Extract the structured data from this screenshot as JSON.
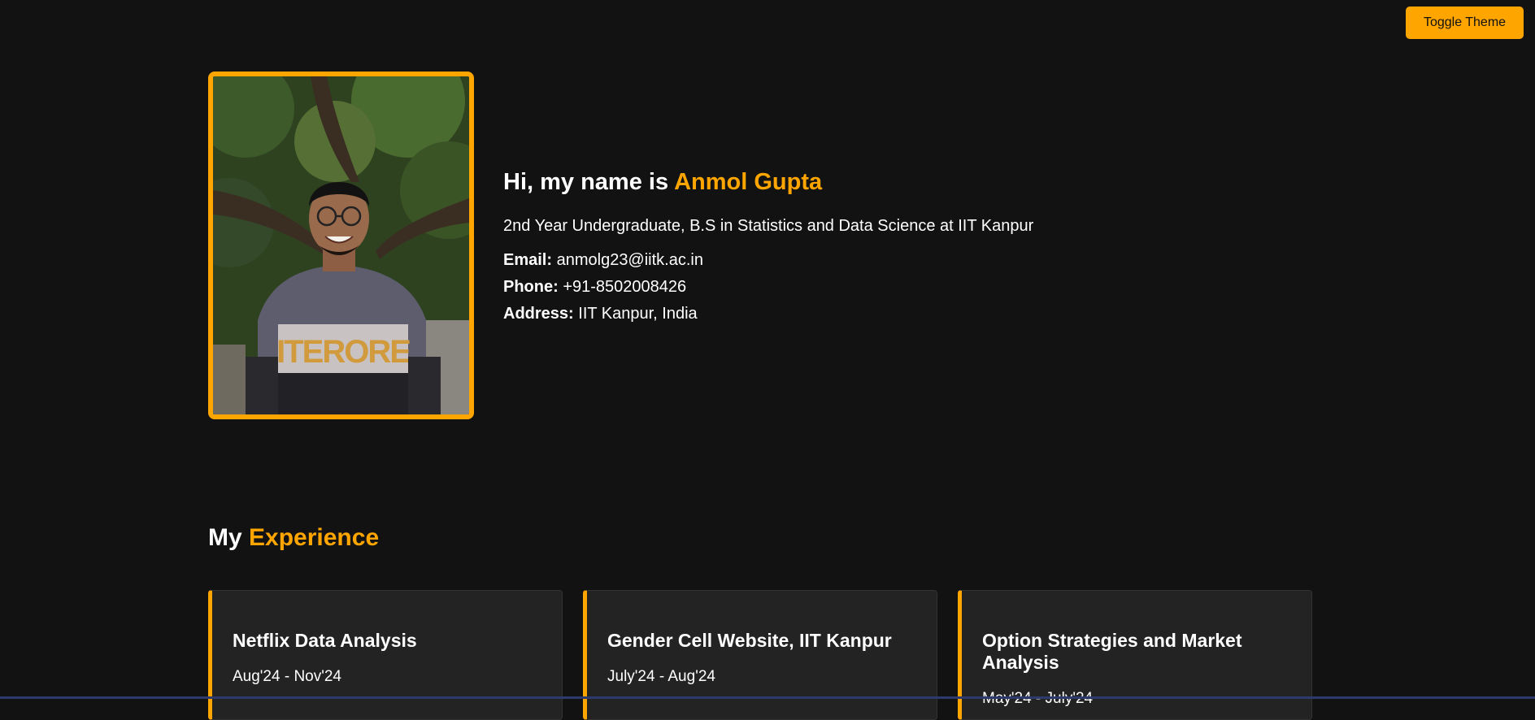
{
  "header": {
    "toggle_label": "Toggle Theme"
  },
  "hero": {
    "greeting": "Hi, my name is",
    "name": "Anmol Gupta",
    "subtitle": "2nd Year Undergraduate, B.S in Statistics and Data Science at IIT Kanpur",
    "contacts": [
      {
        "label": "Email:",
        "value": "anmolg23@iitk.ac.in"
      },
      {
        "label": "Phone:",
        "value": "+91-8502008426"
      },
      {
        "label": "Address:",
        "value": "IIT Kanpur, India"
      }
    ]
  },
  "experience": {
    "title_prefix": "My",
    "title_accent": "Experience",
    "cards": [
      {
        "title": "Netflix Data Analysis",
        "date": "Aug'24 - Nov'24"
      },
      {
        "title": "Gender Cell Website, IIT Kanpur",
        "date": "July'24 - Aug'24"
      },
      {
        "title": "Option Strategies and Market Analysis",
        "date": "May'24 - July'24"
      }
    ]
  },
  "colors": {
    "background": "#121212",
    "accent": "#ffa500",
    "card_bg": "#232323"
  }
}
